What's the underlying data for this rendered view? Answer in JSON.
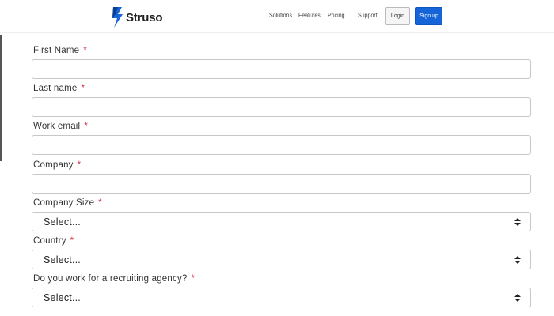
{
  "brand": {
    "name": "Struso"
  },
  "nav": {
    "links": [
      "Solutions",
      "Features",
      "Pricing",
      "Support"
    ],
    "login": "Login",
    "signup": "Sign up"
  },
  "form": {
    "required_marker": "*",
    "fields": [
      {
        "label": "First Name",
        "type": "text",
        "value": ""
      },
      {
        "label": "Last name",
        "type": "text",
        "value": ""
      },
      {
        "label": "Work email",
        "type": "text",
        "value": ""
      },
      {
        "label": "Company",
        "type": "text",
        "value": ""
      },
      {
        "label": "Company Size",
        "type": "select",
        "value": "Select..."
      },
      {
        "label": "Country",
        "type": "select",
        "value": "Select..."
      },
      {
        "label": "Do you work for a recruiting agency?",
        "type": "select",
        "value": "Select..."
      }
    ]
  },
  "colors": {
    "accent": "#1565d8",
    "required": "#d2334b"
  }
}
